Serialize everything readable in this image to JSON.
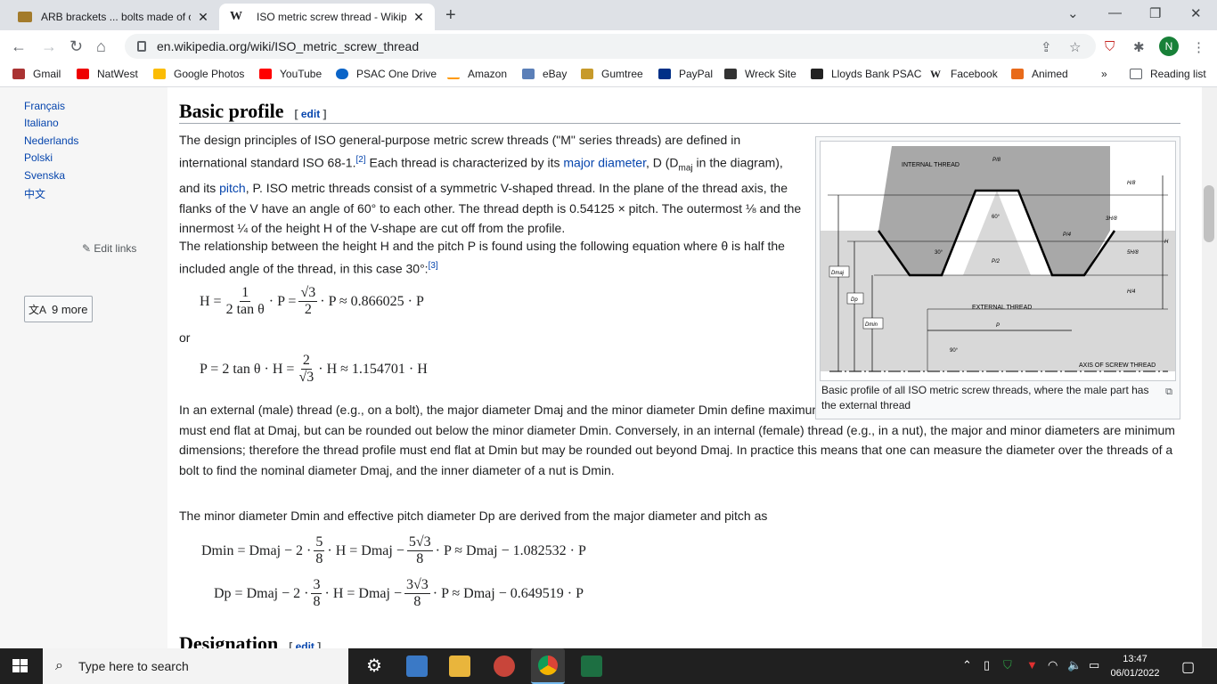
{
  "browser": {
    "tabs": [
      {
        "title": "ARB brackets ... bolts made of ch",
        "active": false
      },
      {
        "title": "ISO metric screw thread - Wikipe",
        "active": true
      }
    ],
    "url": "en.wikipedia.org/wiki/ISO_metric_screw_thread",
    "profile_initial": "N",
    "bookmarks": [
      "Gmail",
      "NatWest",
      "Google Photos",
      "YouTube",
      "PSAC One Drive",
      "Amazon",
      "eBay",
      "Gumtree",
      "PayPal",
      "Wreck Site",
      "Lloyds Bank PSAC",
      "Facebook",
      "Animed"
    ],
    "bookmarks_overflow": "»",
    "reading_list": "Reading list"
  },
  "sidebar": {
    "languages": [
      "Français",
      "Italiano",
      "Nederlands",
      "Polski",
      "Svenska",
      "中文"
    ],
    "more_languages": "9 more",
    "edit_links": "Edit links"
  },
  "article": {
    "heading_basic": "Basic profile",
    "edit_label": "edit",
    "heading_designation": "Designation",
    "p1": {
      "a": "The design principles of ISO general-purpose metric screw threads (\"M\" series threads) are defined in international standard ISO 68-1.",
      "ref": "[2]",
      "b": " Each thread is characterized by its ",
      "link_major": "major diameter",
      "c": ", D (D",
      "sub_maj": "maj",
      "d": " in the diagram), and its ",
      "link_pitch": "pitch",
      "e": ", P. ISO metric threads consist of a symmetric V-shaped thread. In the plane of the thread axis, the flanks of the V have an angle of 60° to each other. The thread depth is 0.54125 × pitch. The outermost ⅛ and the innermost ¼ of the height H of the V-shape are cut off from the profile."
    },
    "p2": {
      "a": "The relationship between the height H and the pitch P is found using the following equation where θ is half the included angle of the thread, in this case 30°:",
      "ref": "[3]"
    },
    "eq1": {
      "lhs": "H =",
      "f1_num": "1",
      "f1_den": "2 tan θ",
      "mid": "· P =",
      "f2_num": "√3",
      "f2_den": "2",
      "rhs": "· P ≈ 0.866025 · P"
    },
    "or": "or",
    "eq2": {
      "lhs": "P = 2 tan θ · H =",
      "f_num": "2",
      "f_den": "√3",
      "rhs": "· H ≈ 1.154701 · H"
    },
    "p3": "In an external (male) thread (e.g., on a bolt), the major diameter Dmaj and the minor diameter Dmin define maximum dimensions of the thread. This means that the external thread must end flat at Dmaj, but can be rounded out below the minor diameter Dmin. Conversely, in an internal (female) thread (e.g., in a nut), the major and minor diameters are minimum dimensions; therefore the thread profile must end flat at Dmin but may be rounded out beyond Dmaj. In practice this means that one can measure the diameter over the threads of a bolt to find the nominal diameter Dmaj, and the inner diameter of a nut is Dmin.",
    "p4": "The minor diameter Dmin and effective pitch diameter Dp are derived from the major diameter and pitch as",
    "eq3": {
      "lhs": "Dmin = Dmaj − 2 ·",
      "f1_num": "5",
      "f1_den": "8",
      "mid": "· H = Dmaj −",
      "f2_num": "5√3",
      "f2_den": "8",
      "rhs": "· P ≈ Dmaj − 1.082532 · P"
    },
    "eq4": {
      "lhs": "Dp = Dmaj − 2 ·",
      "f1_num": "3",
      "f1_den": "8",
      "mid": "· H = Dmaj −",
      "f2_num": "3√3",
      "f2_den": "8",
      "rhs": "· P ≈ Dmaj − 0.649519 · P"
    }
  },
  "figure": {
    "caption": "Basic profile of all ISO metric screw threads, where the male part has the external thread",
    "labels": {
      "internal": "INTERNAL THREAD",
      "external": "EXTERNAL THREAD",
      "axis": "AXIS OF SCREW THREAD",
      "p8": "P/8",
      "p4": "P/4",
      "p2": "P/2",
      "p": "P",
      "h8": "H/8",
      "h38": "3H/8",
      "h58": "5H/8",
      "h4": "H/4",
      "h": "H",
      "a60": "60°",
      "a30": "30°",
      "a90": "90°",
      "dmaj": "Dmaj",
      "dp": "Dp",
      "dmin": "Dmin"
    }
  },
  "taskbar": {
    "search_placeholder": "Type here to search",
    "time": "13:47",
    "date": "06/01/2022"
  }
}
